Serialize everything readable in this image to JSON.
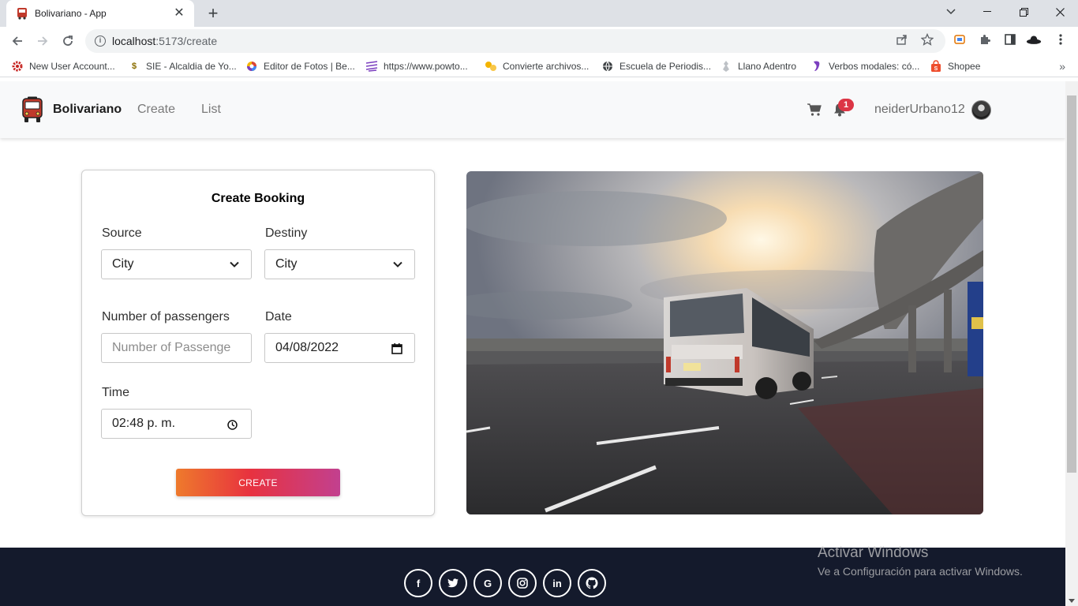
{
  "browser": {
    "tab_title": "Bolivariano - App",
    "url_host": "localhost",
    "url_path": ":5173/create",
    "bookmarks": [
      {
        "label": "New User Account...",
        "icon": "gear-icon",
        "color": "#c5221f"
      },
      {
        "label": "SIE - Alcaldia de Yo...",
        "icon": "s-icon",
        "color": "#8a6d00"
      },
      {
        "label": "Editor de Fotos | Be...",
        "icon": "color-wheel-icon",
        "color": "#7b3fbf"
      },
      {
        "label": "https://www.powto...",
        "icon": "powtoon-icon",
        "color": "#7b3fbf"
      },
      {
        "label": "Convierte archivos...",
        "icon": "convert-icon",
        "color": "#e8a300"
      },
      {
        "label": "Escuela de Periodis...",
        "icon": "globe-icon",
        "color": "#3c4043"
      },
      {
        "label": "Llano Adentro",
        "icon": "llano-icon",
        "color": "#9aa0a6"
      },
      {
        "label": "Verbos modales: có...",
        "icon": "verbos-icon",
        "color": "#7b3fbf"
      },
      {
        "label": "Shopee",
        "icon": "shopee-icon",
        "color": "#ee4d2d"
      }
    ]
  },
  "nav": {
    "brand": "Bolivariano",
    "links": [
      "Create",
      "List"
    ],
    "notifications_count": "1",
    "username": "neiderUrbano12"
  },
  "form": {
    "title": "Create Booking",
    "source_label": "Source",
    "source_value": "City",
    "destiny_label": "Destiny",
    "destiny_value": "City",
    "passengers_label": "Number of passengers",
    "passengers_placeholder": "Number of Passenge",
    "date_label": "Date",
    "date_value": "04/08/2022",
    "time_label": "Time",
    "time_value": "02:48 p. m.",
    "submit_label": "CREATE"
  },
  "footer": {
    "socials": [
      "facebook-icon",
      "twitter-icon",
      "google-icon",
      "instagram-icon",
      "linkedin-icon",
      "github-icon"
    ]
  },
  "watermark": {
    "title": "Activar Windows",
    "subtitle": "Ve a Configuración para activar Windows."
  },
  "colors": {
    "accent_gradient": [
      "#ee7a2c",
      "#e8323f",
      "#c2408f"
    ],
    "footer_bg": "#141a2c",
    "badge": "#dc3545"
  }
}
